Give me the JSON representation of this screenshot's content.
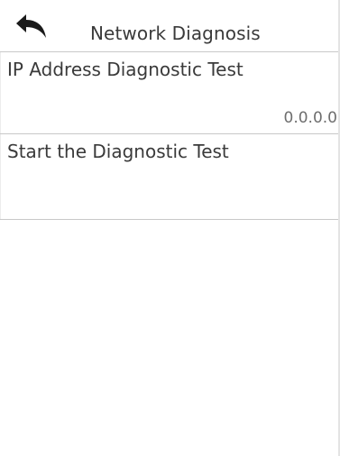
{
  "header": {
    "title": "Network Diagnosis",
    "back_icon": "back-arrow-icon"
  },
  "menu": {
    "items": [
      {
        "label": "IP Address Diagnostic Test",
        "value": "0.0.0.0"
      },
      {
        "label": "Start the Diagnostic Test"
      }
    ]
  },
  "colors": {
    "background": "#ffffff",
    "divider": "#c8c8c8",
    "text": "#3a3a3a",
    "value_text": "#6e6e6e"
  }
}
